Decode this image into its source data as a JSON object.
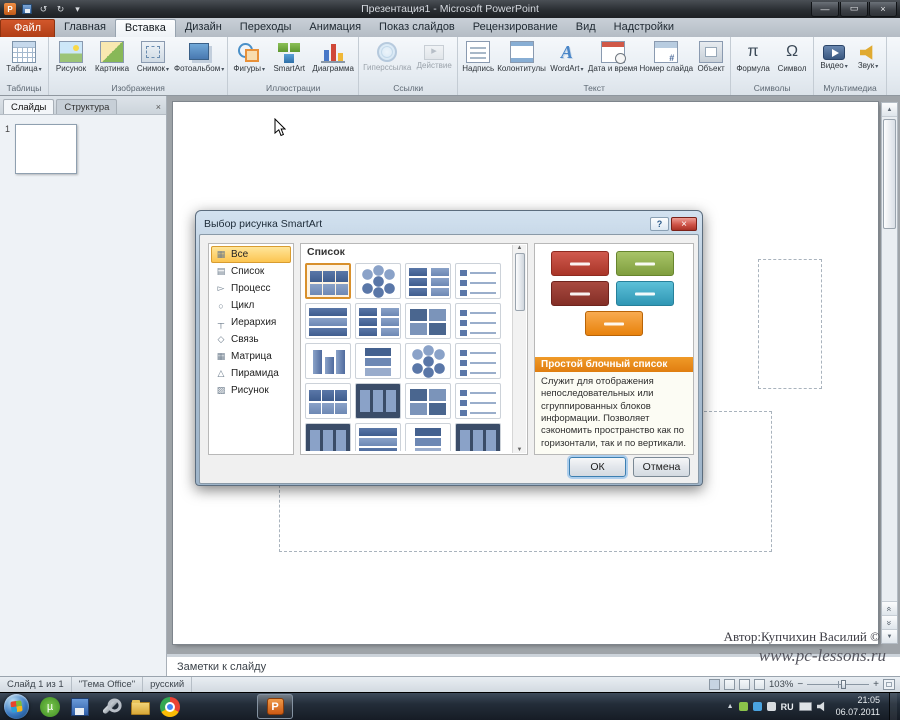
{
  "icons": {
    "dropdown": "▾",
    "minimize": "—",
    "maximize": "▭",
    "close": "×",
    "undo": "↺",
    "redo": "↻",
    "qat_menu": "▾",
    "dialog_help": "?",
    "dialog_close": "×",
    "panel_close": "×",
    "scroll_up": "▲",
    "scroll_down": "▼",
    "prev_slide": "«",
    "next_slide": "»",
    "tray_expand": "▲",
    "ppt_glyph": "P",
    "utorrent_glyph": "µ",
    "wordart_glyph": "А",
    "formula_glyph": "π",
    "symbol_glyph": "Ω",
    "zoom_out": "−",
    "zoom_in": "+"
  },
  "titlebar": {
    "title": "Презентация1 - Microsoft PowerPoint"
  },
  "ribbon": {
    "active_tab": "Вставка",
    "tabs": [
      {
        "label": "Файл"
      },
      {
        "label": "Главная"
      },
      {
        "label": "Вставка"
      },
      {
        "label": "Дизайн"
      },
      {
        "label": "Переходы"
      },
      {
        "label": "Анимация"
      },
      {
        "label": "Показ слайдов"
      },
      {
        "label": "Рецензирование"
      },
      {
        "label": "Вид"
      },
      {
        "label": "Надстройки"
      }
    ],
    "groups": [
      {
        "label": "Таблицы",
        "buttons": [
          {
            "label": "Таблица"
          }
        ]
      },
      {
        "label": "Изображения",
        "buttons": [
          {
            "label": "Рисунок"
          },
          {
            "label": "Картинка"
          },
          {
            "label": "Снимок"
          },
          {
            "label": "Фотоальбом"
          }
        ]
      },
      {
        "label": "Иллюстрации",
        "buttons": [
          {
            "label": "Фигуры"
          },
          {
            "label": "SmartArt"
          },
          {
            "label": "Диаграмма"
          }
        ]
      },
      {
        "label": "Ссылки",
        "buttons": [
          {
            "label": "Гиперссылка"
          },
          {
            "label": "Действие"
          }
        ]
      },
      {
        "label": "Текст",
        "buttons": [
          {
            "label": "Надпись"
          },
          {
            "label": "Колонтитулы"
          },
          {
            "label": "WordArt"
          },
          {
            "label": "Дата и время"
          },
          {
            "label": "Номер слайда"
          },
          {
            "label": "Объект"
          }
        ]
      },
      {
        "label": "Символы",
        "buttons": [
          {
            "label": "Формула"
          },
          {
            "label": "Символ"
          }
        ]
      },
      {
        "label": "Мультимедиа",
        "buttons": [
          {
            "label": "Видео"
          },
          {
            "label": "Звук"
          }
        ]
      }
    ]
  },
  "left_panel": {
    "tabs": [
      {
        "label": "Слайды"
      },
      {
        "label": "Структура"
      }
    ],
    "slide_number": "1"
  },
  "dialog": {
    "title": "Выбор рисунка SmartArt",
    "selected_category": "Все",
    "categories": [
      {
        "label": "Все",
        "icon": "▦"
      },
      {
        "label": "Список",
        "icon": "▤"
      },
      {
        "label": "Процесс",
        "icon": "▻"
      },
      {
        "label": "Цикл",
        "icon": "○"
      },
      {
        "label": "Иерархия",
        "icon": "┬"
      },
      {
        "label": "Связь",
        "icon": "◇"
      },
      {
        "label": "Матрица",
        "icon": "▦"
      },
      {
        "label": "Пирамида",
        "icon": "△"
      },
      {
        "label": "Рисунок",
        "icon": "▨"
      }
    ],
    "gallery_header": "Список",
    "gallery_patterns": [
      "blocks",
      "hex",
      "cols2",
      "lines",
      "rows",
      "cols2",
      "grid4",
      "lines",
      "cyl",
      "stack",
      "hex",
      "lines",
      "blocks",
      "dark",
      "grid4",
      "lines",
      "dark",
      "rows",
      "stack",
      "dark"
    ],
    "preview": {
      "title": "Простой блочный список",
      "description": "Служит для отображения непоследовательных или сгруппированных блоков информации. Позволяет сэкономить пространство как по горизонтали, так и по вертикали."
    },
    "ok_label": "ОК",
    "cancel_label": "Отмена"
  },
  "notes": {
    "placeholder": "Заметки к слайду"
  },
  "status_bar": {
    "slide_info": "Слайд 1 из 1",
    "theme": "\"Тема Office\"",
    "language": "русский",
    "zoom_level": "103%"
  },
  "watermark": {
    "author": "Автор:Купчихин Василий ©",
    "website": "www.pc-lessons.ru"
  },
  "taskbar": {
    "tray": {
      "language": "RU",
      "time": "21:05",
      "date": "06.07.2011"
    }
  }
}
